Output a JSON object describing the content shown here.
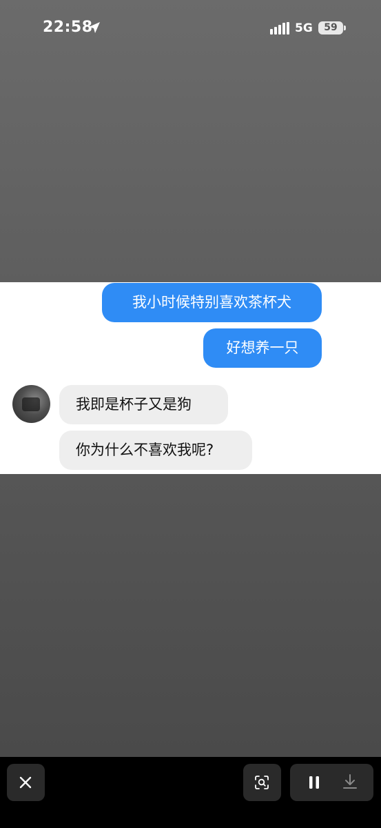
{
  "status_bar": {
    "time": "22:58",
    "location_icon": "location-arrow-icon",
    "signal_icon": "cellular-signal-icon",
    "network": "5G",
    "battery": "59"
  },
  "chat": {
    "messages": [
      {
        "direction": "outgoing",
        "text": "我小时候特别喜欢茶杯犬"
      },
      {
        "direction": "outgoing",
        "text": "好想养一只"
      },
      {
        "direction": "incoming",
        "text": "我即是杯子又是狗"
      },
      {
        "direction": "incoming",
        "text": "你为什么不喜欢我呢?"
      }
    ]
  },
  "bottom_bar": {
    "close_icon": "close-icon",
    "scan_icon": "scan-search-icon",
    "pause_icon": "pause-icon",
    "download_icon": "download-icon"
  },
  "colors": {
    "outgoing_bubble": "#2f8cf5",
    "incoming_bubble": "#eeeeee",
    "background_top": "#6b6b6b",
    "background_bottom": "#4a4a4a"
  }
}
